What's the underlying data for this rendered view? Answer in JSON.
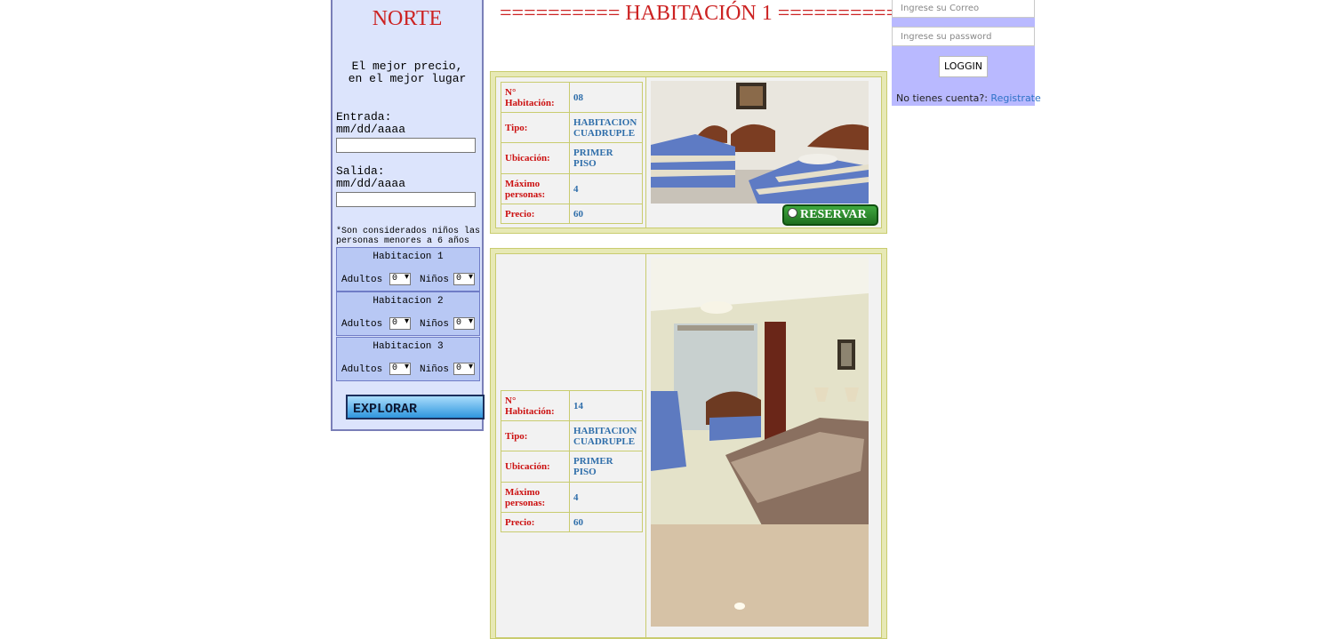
{
  "search": {
    "brand_top": "====== ======",
    "brand": "NORTE",
    "slogan_line1": "El mejor precio,",
    "slogan_line2": "en el mejor lugar",
    "checkin_label": "Entrada:",
    "checkin_format": "mm/dd/aaaa",
    "checkout_label": "Salida:",
    "checkout_format": "mm/dd/aaaa",
    "note": "*Son considerados niños las personas menores a 6 años",
    "rooms": [
      {
        "title": "Habitacion 1",
        "adults_label": "Adultos",
        "adults_value": "0",
        "children_label": "Niños",
        "children_value": "0"
      },
      {
        "title": "Habitacion 2",
        "adults_label": "Adultos",
        "adults_value": "0",
        "children_label": "Niños",
        "children_value": "0"
      },
      {
        "title": "Habitacion 3",
        "adults_label": "Adultos",
        "adults_value": "0",
        "children_label": "Niños",
        "children_value": "0"
      }
    ],
    "explore_label": "EXPLORAR"
  },
  "heading": "========== HABITACIÓN 1 ==========",
  "labels": {
    "number": "N° Habitación:",
    "type": "Tipo:",
    "location": "Ubicación:",
    "max_people": "Máximo personas:",
    "price": "Precio:"
  },
  "rooms": [
    {
      "number": "08",
      "type": "HABITACION CUADRUPLE",
      "location": "PRIMER PISO",
      "max_people": "4",
      "price": "60",
      "reserve_label": "RESERVAR"
    },
    {
      "number": "14",
      "type": "HABITACION CUADRUPLE",
      "location": "PRIMER PISO",
      "max_people": "4",
      "price": "60"
    }
  ],
  "login": {
    "email_placeholder": "Ingrese su Correo",
    "password_placeholder": "Ingrese su password",
    "button_label": "LOGGIN",
    "no_account_text": "No tienes cuenta?:",
    "register_link": "Registrate"
  }
}
